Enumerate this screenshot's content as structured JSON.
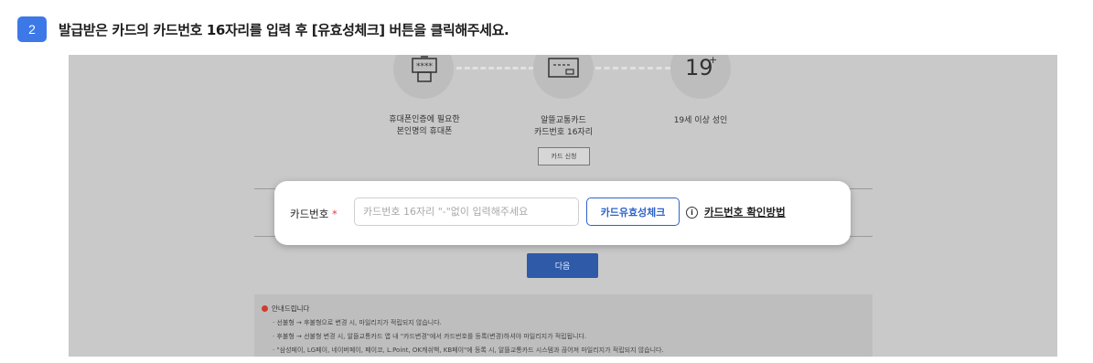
{
  "step": {
    "number": "2",
    "instruction": "발급받은 카드의 카드번호 16자리를 입력 후 [유효성체크] 버튼을 클릭해주세요."
  },
  "requirements": [
    {
      "icon": "phone-keypad-icon",
      "caption_line1": "휴대폰인증에 필요한",
      "caption_line2": "본인명의 휴대폰"
    },
    {
      "icon": "card-icon",
      "caption_line1": "알뜰교통카드",
      "caption_line2": "카드번호 16자리",
      "button": "카드 신청"
    },
    {
      "icon": "age-19-plus-icon",
      "caption_line1": "19세 이상 성인",
      "caption_line2": ""
    }
  ],
  "form": {
    "label": "카드번호",
    "required_mark": "*",
    "placeholder": "카드번호 16자리 \"-\"없이 입력해주세요",
    "value": "",
    "check_button": "카드유효성체크",
    "help_link": "카드번호 확인방법"
  },
  "next_button": "다음",
  "notice": {
    "title": "안내드립니다",
    "lines": [
      "· 선불형 → 후불형으로 변경 시, 마일리지가 적립되지 않습니다.",
      "· 후불형 → 선불형 변경 시, 알뜰교통카드 앱 내 \"카드변경\"에서 카드번호를 등록(변경)하셔야 마일리지가 적립됩니다.",
      "· \"삼성페이, LG페이, 네이버페이, 페이코, L.Point, OK캐쉬백, KB페이\"에 등록 시, 알뜰교통카드 시스템과 끊어져 마일리지가 적립되지 않습니다."
    ]
  },
  "colors": {
    "accent": "#3c78e8",
    "link_blue": "#2e63c9",
    "required_red": "#e0413a",
    "overlay_gray": "#c9c9c9"
  }
}
